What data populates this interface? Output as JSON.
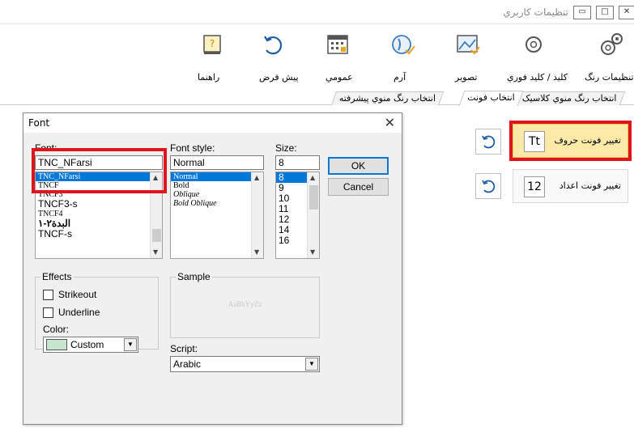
{
  "window": {
    "title": "تنظیمات کاربري",
    "close_glyph": "✕",
    "max_glyph": "□",
    "min_glyph": "▭"
  },
  "ribbon": {
    "items": [
      {
        "label": "تنظیمات رنگ",
        "icon": "gears-icon"
      },
      {
        "label": "کلید / کلید فوري",
        "icon": "key-icon"
      },
      {
        "label": "تصویر",
        "icon": "picture-icon"
      },
      {
        "label": "آرم",
        "icon": "logo-icon"
      },
      {
        "label": "عمومي",
        "icon": "calendar-icon"
      },
      {
        "label": "پیش فرض",
        "icon": "undo-icon"
      },
      {
        "label": "راهنما",
        "icon": "help-icon"
      }
    ]
  },
  "tabs": [
    {
      "label": "انتخاب رنگ منوي کلاسیک"
    },
    {
      "label": "انتخاب فونت"
    },
    {
      "label": "انتخاب رنگ منوي پیشرفته"
    }
  ],
  "side_buttons": {
    "letter_font": {
      "label": "تغییر فونت حروف",
      "icon_text": "Tt"
    },
    "number_font": {
      "label": "تغییر فونت اعداد",
      "icon_text": "12"
    }
  },
  "font_dialog": {
    "title": "Font",
    "close_glyph": "✕",
    "font_label": "Font:",
    "font_value": "TNC_NFarsi",
    "font_list": [
      "TNC_NFarsi",
      "TNCF",
      "TNCF3",
      "TNCF3-s",
      "TNCF4",
      "۱-۲البدة",
      "TNCF-s"
    ],
    "style_label": "Font style:",
    "style_value": "Normal",
    "style_list": [
      "Normal",
      "Bold",
      "Oblique",
      "Bold Oblique"
    ],
    "size_label": "Size:",
    "size_value": "8",
    "size_list": [
      "8",
      "9",
      "10",
      "11",
      "12",
      "14",
      "16"
    ],
    "ok_label": "OK",
    "cancel_label": "Cancel",
    "effects_label": "Effects",
    "strikeout_label": "Strikeout",
    "underline_label": "Underline",
    "color_label": "Color:",
    "color_value": "Custom",
    "color_swatch": "#c6e6cf",
    "sample_label": "Sample",
    "sample_text": "AaBbYyZz",
    "script_label": "Script:",
    "script_value": "Arabic"
  },
  "colors": {
    "highlight": "#fde9a8",
    "annotation_red": "#e0151b",
    "selection": "#0078d7"
  }
}
